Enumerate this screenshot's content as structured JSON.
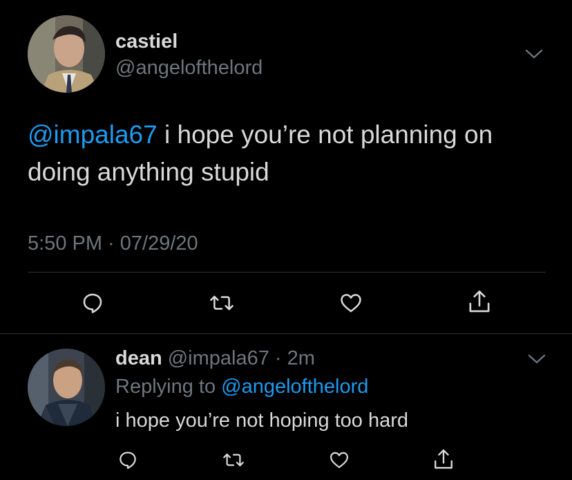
{
  "main_tweet": {
    "author_name": "castiel",
    "author_handle": "@angelofthelord",
    "mention": "@impala67",
    "text": " i hope you’re not planning on doing anything stupid",
    "time": "5:50 PM",
    "separator": " · ",
    "date": "07/29/20",
    "icons": {
      "reply": "reply-icon",
      "retweet": "retweet-icon",
      "like": "heart-icon",
      "share": "share-icon",
      "more": "chevron-down-icon"
    }
  },
  "reply_tweet": {
    "author_name": "dean",
    "author_handle": " @impala67",
    "separator": " · ",
    "age": "2m",
    "replying_prefix": "Replying to ",
    "replying_to": "@angelofthelord",
    "text": "i hope you’re not hoping too hard"
  },
  "colors": {
    "background": "#000000",
    "text": "#d9d9d9",
    "muted": "#6e767d",
    "accent": "#1d9bf0",
    "divider": "#2f3336"
  }
}
